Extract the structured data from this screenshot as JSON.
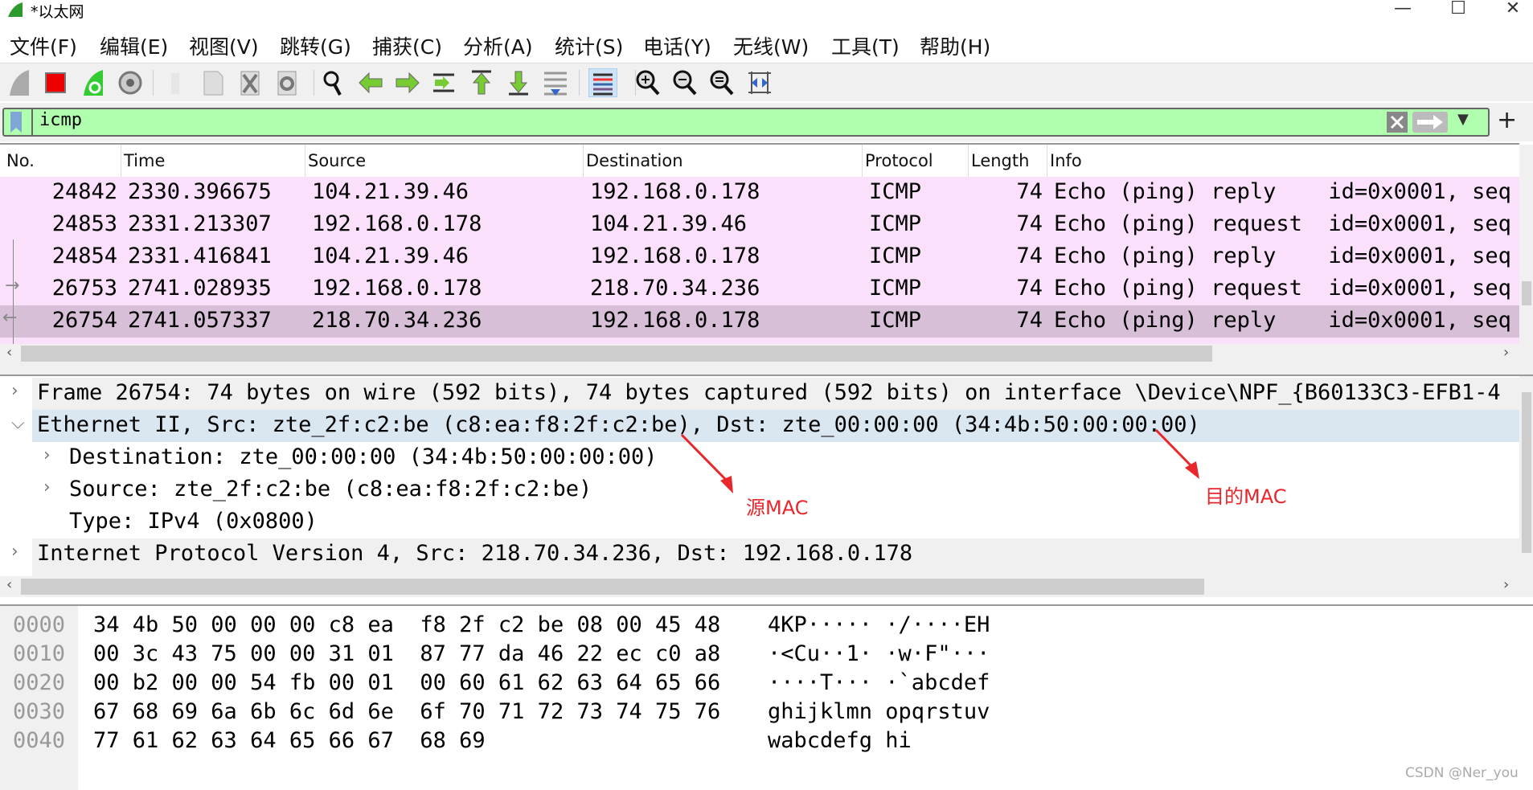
{
  "window": {
    "title": "*以太网",
    "controls": [
      "minimize",
      "maximize",
      "close"
    ]
  },
  "menu": [
    "文件(F)",
    "编辑(E)",
    "视图(V)",
    "跳转(G)",
    "捕获(C)",
    "分析(A)",
    "统计(S)",
    "电话(Y)",
    "无线(W)",
    "工具(T)",
    "帮助(H)"
  ],
  "toolbar": [
    "start-capture-icon",
    "stop-capture-icon",
    "restart-capture-icon",
    "capture-options-icon",
    "open-file-icon",
    "save-file-icon",
    "close-file-icon",
    "reload-file-icon",
    "find-packet-icon",
    "go-back-icon",
    "go-forward-icon",
    "go-to-packet-icon",
    "go-first-icon",
    "go-last-icon",
    "auto-scroll-icon",
    "colorize-icon",
    "zoom-in-icon",
    "zoom-out-icon",
    "zoom-normal-icon",
    "resize-columns-icon"
  ],
  "filter": {
    "value": "icmp",
    "color": "#afffaf"
  },
  "packet_list": {
    "columns": [
      "No.",
      "Time",
      "Source",
      "Destination",
      "Protocol",
      "Length",
      "Info"
    ],
    "rows": [
      {
        "no": "24842",
        "time": "2330.396675",
        "src": "104.21.39.46",
        "dst": "192.168.0.178",
        "proto": "ICMP",
        "len": "74",
        "info": "Echo (ping) reply    id=0x0001, seq"
      },
      {
        "no": "24853",
        "time": "2331.213307",
        "src": "192.168.0.178",
        "dst": "104.21.39.46",
        "proto": "ICMP",
        "len": "74",
        "info": "Echo (ping) request  id=0x0001, seq"
      },
      {
        "no": "24854",
        "time": "2331.416841",
        "src": "104.21.39.46",
        "dst": "192.168.0.178",
        "proto": "ICMP",
        "len": "74",
        "info": "Echo (ping) reply    id=0x0001, seq"
      },
      {
        "no": "26753",
        "time": "2741.028935",
        "src": "192.168.0.178",
        "dst": "218.70.34.236",
        "proto": "ICMP",
        "len": "74",
        "info": "Echo (ping) request  id=0x0001, seq"
      },
      {
        "no": "26754",
        "time": "2741.057337",
        "src": "218.70.34.236",
        "dst": "192.168.0.178",
        "proto": "ICMP",
        "len": "74",
        "info": "Echo (ping) reply    id=0x0001, seq",
        "selected": true
      }
    ],
    "row_color": "#fbe0fb",
    "selected_color": "#d7bfd7"
  },
  "details": [
    {
      "text": "Frame 26754: 74 bytes on wire (592 bits), 74 bytes captured (592 bits) on interface \\Device\\NPF_{B60133C3-EFB1-4",
      "level": 0,
      "expander": "collapsed"
    },
    {
      "text": "Ethernet II, Src: zte_2f:c2:be (c8:ea:f8:2f:c2:be), Dst: zte_00:00:00 (34:4b:50:00:00:00)",
      "level": 0,
      "expander": "expanded",
      "selected": true
    },
    {
      "text": "Destination: zte_00:00:00 (34:4b:50:00:00:00)",
      "level": 1,
      "expander": "collapsed"
    },
    {
      "text": "Source: zte_2f:c2:be (c8:ea:f8:2f:c2:be)",
      "level": 1,
      "expander": "collapsed"
    },
    {
      "text": "Type: IPv4 (0x0800)",
      "level": 1,
      "expander": "none"
    },
    {
      "text": "Internet Protocol Version 4, Src: 218.70.34.236, Dst: 192.168.0.178",
      "level": 0,
      "expander": "collapsed"
    }
  ],
  "annotations": {
    "src_mac": "源MAC",
    "dst_mac": "目的MAC",
    "color": "#e8262b"
  },
  "bytes": [
    {
      "offset": "0000",
      "hex": "34 4b 50 00 00 00 c8 ea  f8 2f c2 be 08 00 45 48",
      "ascii": "4KP····· ·/····EH"
    },
    {
      "offset": "0010",
      "hex": "00 3c 43 75 00 00 31 01  87 77 da 46 22 ec c0 a8",
      "ascii": "·<Cu··1· ·w·F\"···"
    },
    {
      "offset": "0020",
      "hex": "00 b2 00 00 54 fb 00 01  00 60 61 62 63 64 65 66",
      "ascii": "····T··· ·`abcdef"
    },
    {
      "offset": "0030",
      "hex": "67 68 69 6a 6b 6c 6d 6e  6f 70 71 72 73 74 75 76",
      "ascii": "ghijklmn opqrstuv"
    },
    {
      "offset": "0040",
      "hex": "77 61 62 63 64 65 66 67  68 69",
      "ascii": "wabcdefg hi"
    }
  ],
  "watermark": "CSDN @Ner_you"
}
